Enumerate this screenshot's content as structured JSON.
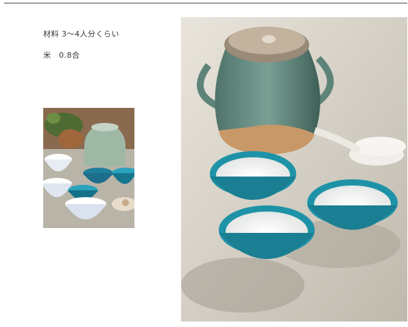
{
  "ingredients": {
    "heading": "材料 3〜4人分くらい",
    "rice": "米　0.8合"
  },
  "images": {
    "small_photo": {
      "subject": "celadon-pot-with-blue-patterned-bowls"
    },
    "large_photo": {
      "subject": "celadon-pot-with-three-bowls-of-rice-porridge-and-spoons"
    }
  },
  "colors": {
    "rule": "#444444",
    "text": "#333333",
    "celadon": "#6f9186",
    "turquoise": "#1e93a8",
    "terracotta": "#b98a5c",
    "floor": "#d8d3c8"
  }
}
